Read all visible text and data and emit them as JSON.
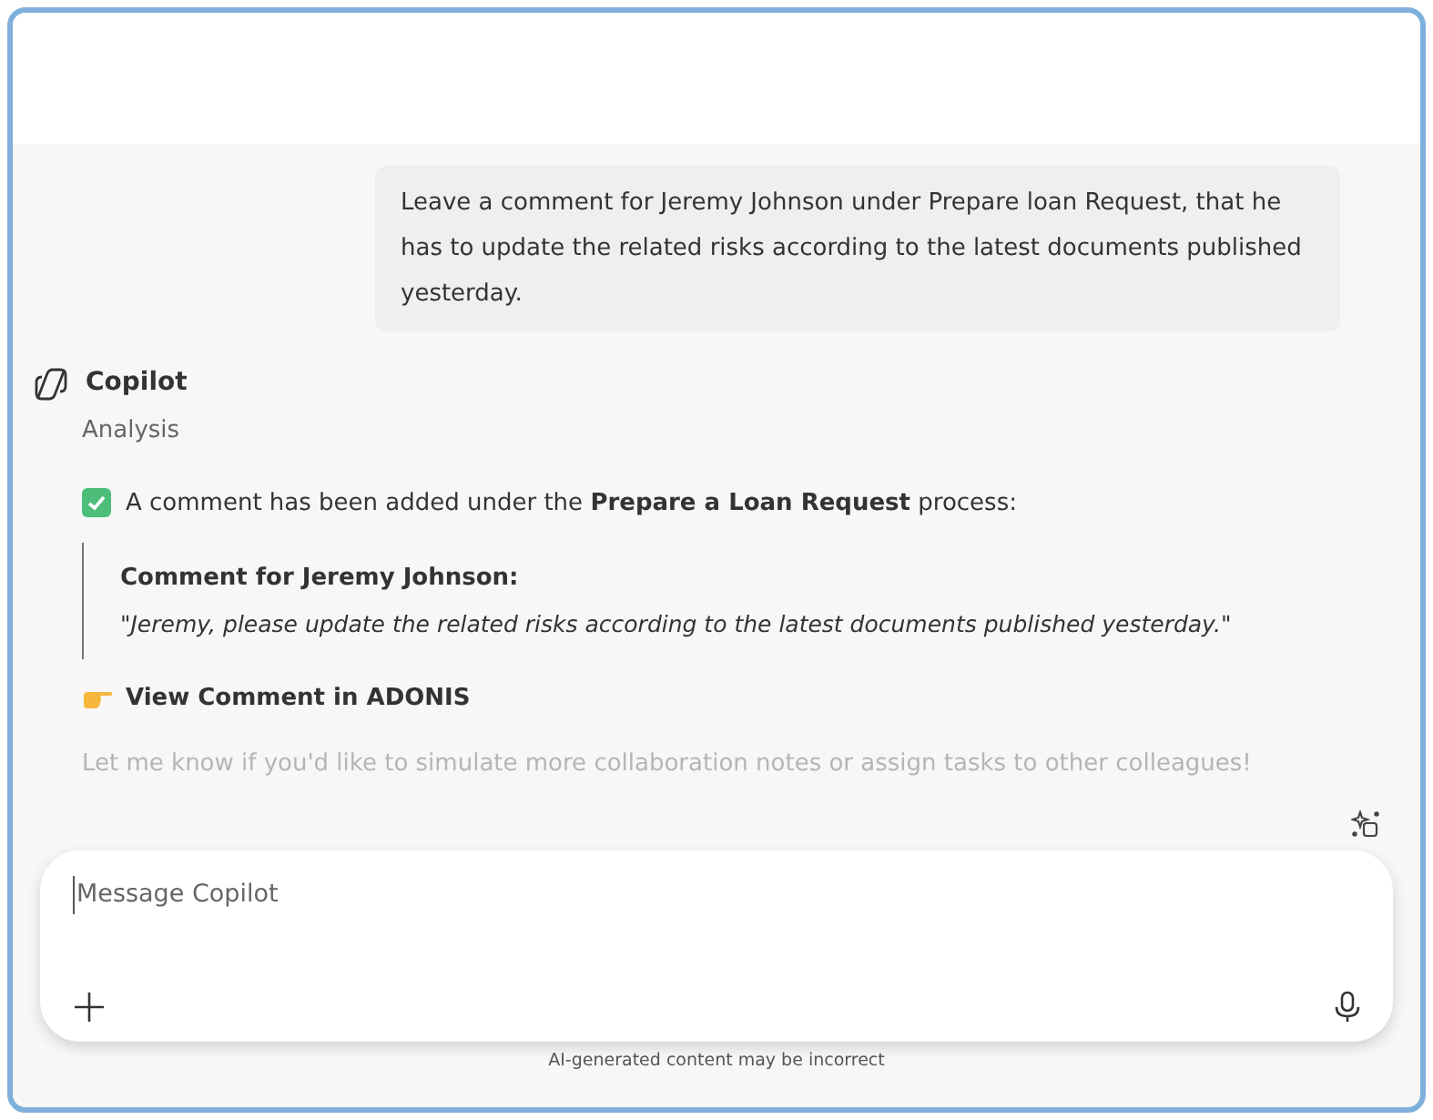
{
  "user_message": "Leave a comment for Jeremy Johnson under Prepare loan Request, that he has to update the related risks according to the latest documents published yesterday.",
  "assistant": {
    "name": "Copilot",
    "subtitle": "Analysis",
    "confirmation": "A comment has been added under the **Prepare a Loan Request** process:",
    "quote_title": "Comment for Jeremy Johnson:",
    "quote_text": "\"Jeremy, please update the related risks according to the latest documents published yesterday.\"",
    "link": "View Comment in ADONIS",
    "follow_up": "Let me know if you'd like to simulate more collaboration notes or assign tasks to other colleagues!"
  },
  "composer": {
    "placeholder": "Message Copilot"
  },
  "disclaimer": "AI-generated content may be incorrect"
}
